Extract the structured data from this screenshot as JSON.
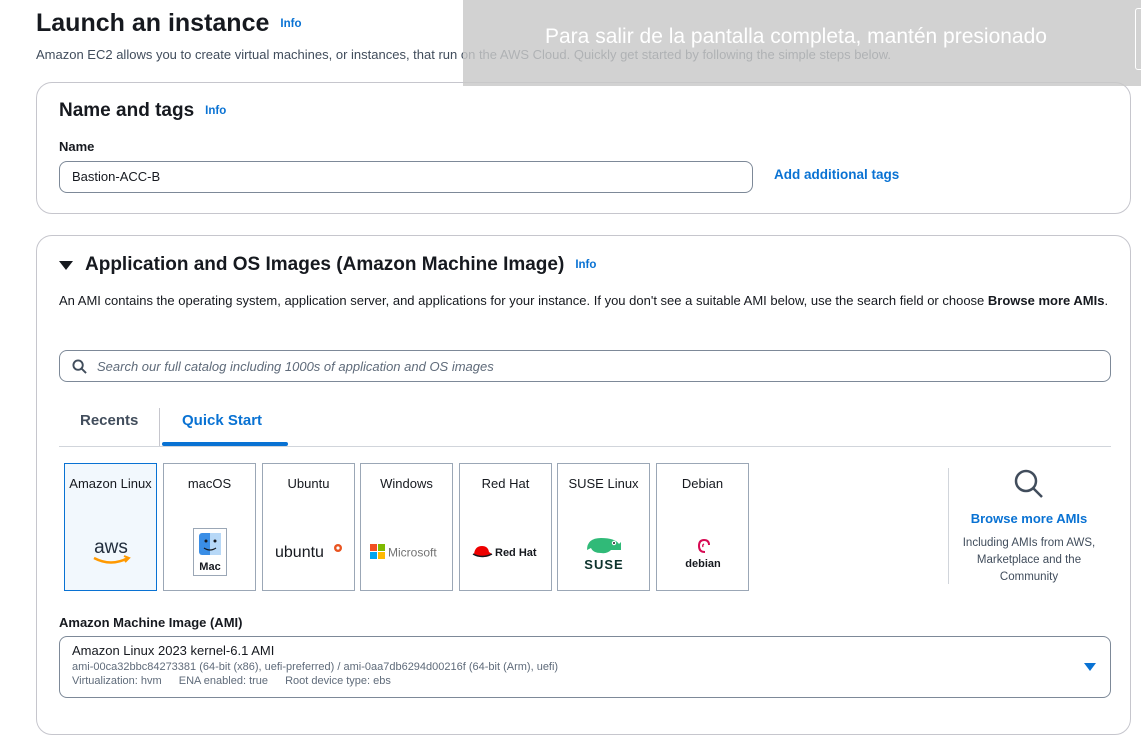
{
  "page": {
    "title": "Launch an instance",
    "info": "Info",
    "description": "Amazon EC2 allows you to create virtual machines, or instances, that run on the AWS Cloud. Quickly get started by following the simple steps below."
  },
  "fullscreen_notice": "Para salir de la pantalla completa, mantén presionado",
  "name_and_tags": {
    "heading": "Name and tags",
    "info": "Info",
    "name_label": "Name",
    "name_value": "Bastion-ACC-B",
    "add_tags_link": "Add additional tags"
  },
  "ami_section": {
    "heading": "Application and OS Images (Amazon Machine Image)",
    "info": "Info",
    "description_plain": "An AMI contains the operating system, application server, and applications for your instance. If you don't see a suitable AMI below, use the search field or choose ",
    "description_bold": "Browse more AMIs",
    "description_end": ".",
    "search_placeholder": "Search our full catalog including 1000s of application and OS images",
    "tabs": [
      {
        "label": "Recents",
        "active": false
      },
      {
        "label": "Quick Start",
        "active": true
      }
    ],
    "os_options": [
      {
        "label": "Amazon Linux",
        "logo_text": "aws",
        "selected": true
      },
      {
        "label": "macOS",
        "logo_text": "Mac",
        "selected": false
      },
      {
        "label": "Ubuntu",
        "logo_text": "ubuntu",
        "selected": false
      },
      {
        "label": "Windows",
        "logo_text": "Microsoft",
        "selected": false
      },
      {
        "label": "Red Hat",
        "logo_text": "Red Hat",
        "selected": false
      },
      {
        "label": "SUSE Linux",
        "logo_text": "SUSE",
        "selected": false
      },
      {
        "label": "Debian",
        "logo_text": "debian",
        "selected": false
      }
    ],
    "browse_more": {
      "link": "Browse more AMIs",
      "subtitle": "Including AMIs from AWS, Marketplace and the Community"
    },
    "ami_label": "Amazon Machine Image (AMI)",
    "ami_selected": {
      "name": "Amazon Linux 2023 kernel-6.1 AMI",
      "ids": "ami-00ca32bbc84273381 (64-bit (x86), uefi-preferred) / ami-0aa7db6294d00216f (64-bit (Arm), uefi)",
      "virtualization": "Virtualization: hvm",
      "ena": "ENA enabled: true",
      "root_device": "Root device type: ebs"
    }
  },
  "colors": {
    "link_blue": "#0972d3",
    "text_dark": "#16191f",
    "border": "#c6c6cd",
    "aws_orange": "#ff9900",
    "redhat_red": "#ee0000",
    "suse_green": "#30ba78",
    "ubuntu_orange": "#e95420",
    "debian_red": "#d70a53"
  },
  "icons": {
    "search": "search-icon",
    "collapse": "caret-down-icon",
    "dropdown": "chevron-down-icon",
    "browse": "magnifier-icon"
  }
}
